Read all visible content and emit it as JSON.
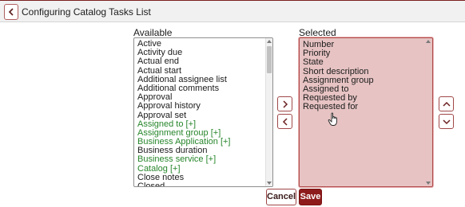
{
  "header": {
    "back_icon": "chevron-left-icon",
    "title": "Configuring Catalog Tasks List"
  },
  "available": {
    "label": "Available",
    "items": [
      {
        "text": "Active",
        "green": false
      },
      {
        "text": "Activity due",
        "green": false
      },
      {
        "text": "Actual end",
        "green": false
      },
      {
        "text": "Actual start",
        "green": false
      },
      {
        "text": "Additional assignee list",
        "green": false
      },
      {
        "text": "Additional comments",
        "green": false
      },
      {
        "text": "Approval",
        "green": false
      },
      {
        "text": "Approval history",
        "green": false
      },
      {
        "text": "Approval set",
        "green": false
      },
      {
        "text": "Assigned to [+]",
        "green": true
      },
      {
        "text": "Assignment group [+]",
        "green": true
      },
      {
        "text": "Business Application [+]",
        "green": true
      },
      {
        "text": "Business duration",
        "green": false
      },
      {
        "text": "Business service [+]",
        "green": true
      },
      {
        "text": "Catalog [+]",
        "green": true
      },
      {
        "text": "Close notes",
        "green": false
      },
      {
        "text": "Closed",
        "green": false
      }
    ]
  },
  "selected": {
    "label": "Selected",
    "items": [
      "Number",
      "Priority",
      "State",
      "Short description",
      "Assignment group",
      "Assigned to",
      "Requested by",
      "Requested for"
    ]
  },
  "buttons": {
    "add_icon": "chevron-right-icon",
    "remove_icon": "chevron-left-icon",
    "move_up_icon": "chevron-up-icon",
    "move_down_icon": "chevron-down-icon",
    "cancel": "Cancel",
    "save": "Save"
  },
  "colors": {
    "accent": "#8e1b1b",
    "selected_bg": "#e7c3c3",
    "reference_field": "#27862b"
  }
}
